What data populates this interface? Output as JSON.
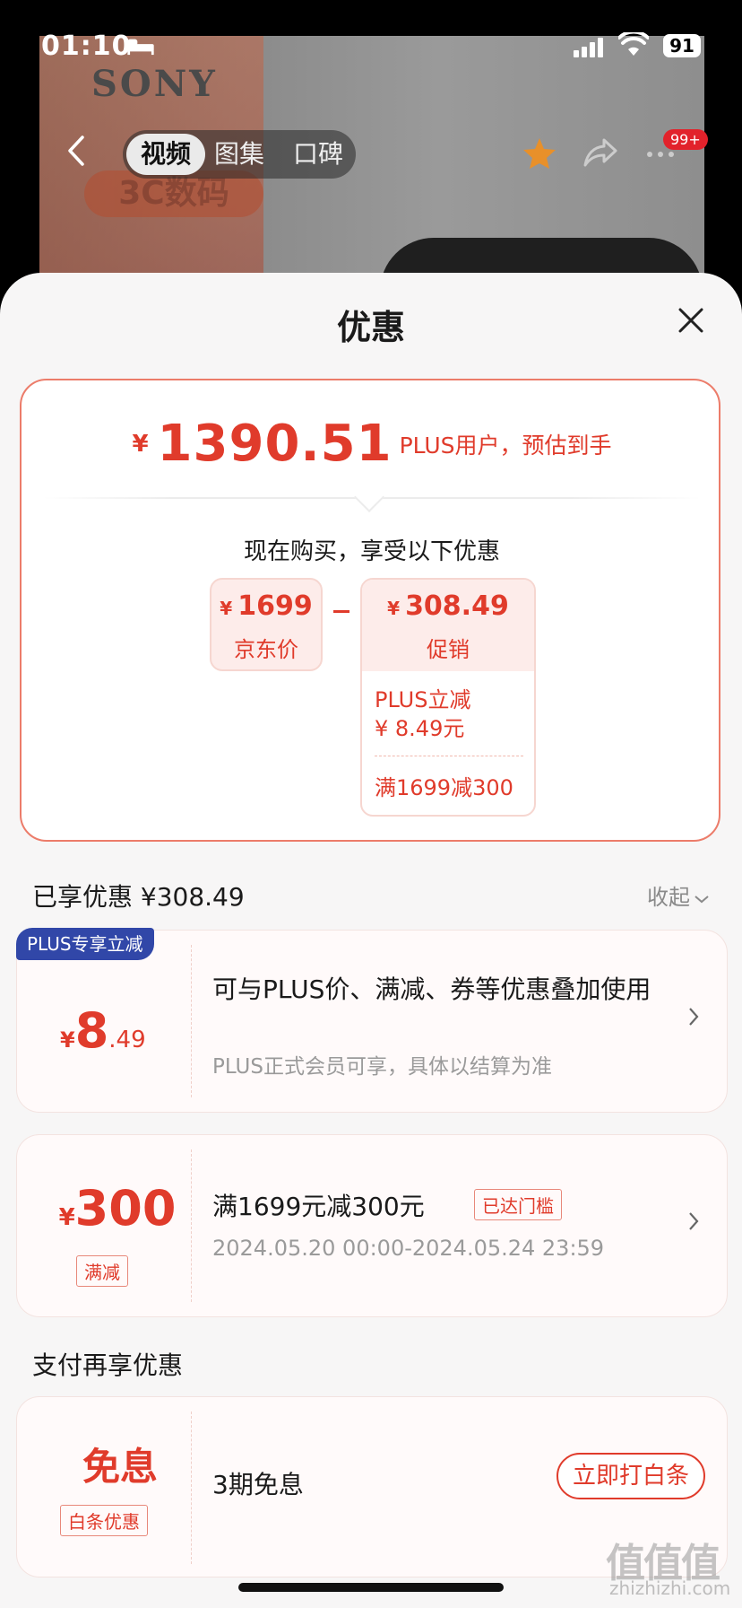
{
  "status_bar": {
    "time": "01:10",
    "battery": "91"
  },
  "product_image": {
    "brand": "SONY",
    "category_label": "3C数码"
  },
  "top_nav": {
    "tabs": [
      {
        "label": "视频",
        "active": true
      },
      {
        "label": "图集",
        "active": false
      },
      {
        "label": "口碑",
        "active": false
      }
    ],
    "notification_badge": "99+"
  },
  "sheet": {
    "title": "优惠",
    "summary": {
      "currency": "¥",
      "final_price": "1390.51",
      "final_note": "PLUS用户，预估到手",
      "buy_now_text": "现在购买，享受以下优惠",
      "jd_price": {
        "currency": "¥",
        "value": "1699",
        "label": "京东价"
      },
      "promo": {
        "currency": "¥",
        "value": "308.49",
        "label": "促销",
        "items": [
          "PLUS立减",
          "¥ 8.49元",
          "满1699减300"
        ]
      }
    },
    "enjoyed": {
      "label": "已享优惠 ¥308.49",
      "collapse": "收起"
    },
    "coupons": [
      {
        "tag": "PLUS专享立减",
        "currency": "¥",
        "amount_main": "8",
        "amount_decimal": ".49",
        "title": "可与PLUS价、满减、券等优惠叠加使用",
        "subtitle": "PLUS正式会员可享，具体以结算为准"
      },
      {
        "currency": "¥",
        "amount_main": "300",
        "type_tag": "满减",
        "title": "满1699元减300元",
        "reached_tag": "已达门槛",
        "date": "2024.05.20 00:00-2024.05.24 23:59"
      }
    ],
    "pay_section": {
      "title": "支付再享优惠",
      "card": {
        "amount": "免息",
        "type_tag": "白条优惠",
        "text": "3期免息",
        "button": "立即打白条"
      }
    }
  },
  "watermark": {
    "main": "值值值",
    "site": "zhizhizhi.com"
  },
  "colors": {
    "accent": "#e03b2b",
    "plus_blue": "#3147a8",
    "border_pink": "#ec7c6a"
  }
}
